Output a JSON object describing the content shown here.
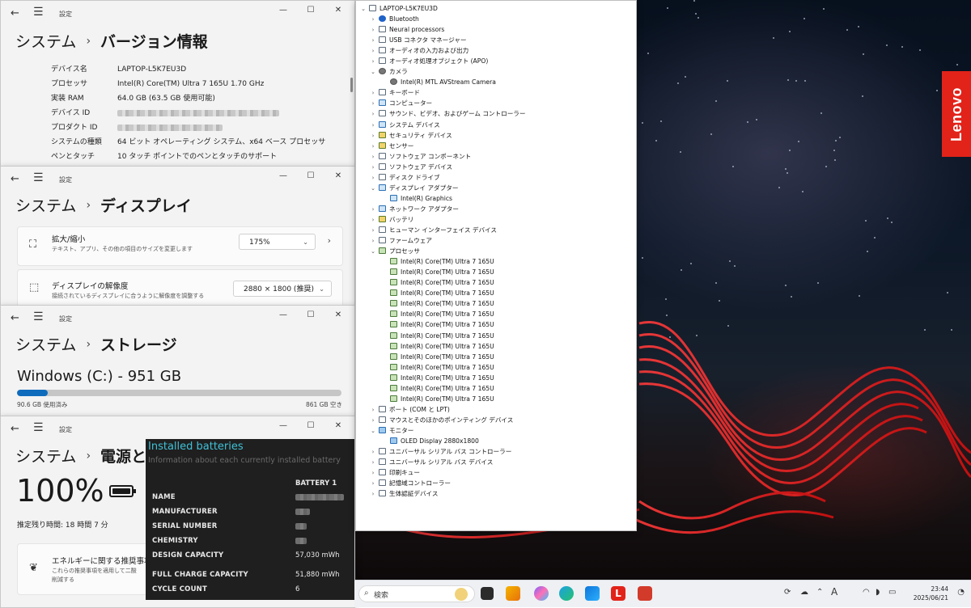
{
  "settings_app": "設定",
  "system_label": "システム",
  "windows": {
    "about": {
      "page_title": "バージョン情報",
      "specs": [
        {
          "key": "デバイス名",
          "value": "LAPTOP-L5K7EU3D"
        },
        {
          "key": "プロセッサ",
          "value": "Intel(R) Core(TM) Ultra 7 165U   1.70 GHz"
        },
        {
          "key": "実装 RAM",
          "value": "64.0 GB (63.5 GB 使用可能)"
        },
        {
          "key": "デバイス ID",
          "value": ""
        },
        {
          "key": "プロダクト ID",
          "value": ""
        },
        {
          "key": "システムの種類",
          "value": "64 ビット オペレーティング システム、x64 ベース プロセッサ"
        },
        {
          "key": "ペンとタッチ",
          "value": "10 タッチ ポイントでのペンとタッチのサポート"
        }
      ]
    },
    "display": {
      "page_title": "ディスプレイ",
      "scale": {
        "title": "拡大/縮小",
        "desc": "テキスト、アプリ、その他の項目のサイズを変更します",
        "value": "175%"
      },
      "resolution": {
        "title": "ディスプレイの解像度",
        "desc": "接続されているディスプレイに合うように解像度を調整する",
        "value": "2880 × 1800 (推奨)"
      }
    },
    "storage": {
      "page_title": "ストレージ",
      "drive": "Windows (C:) - 951 GB",
      "used": "90.6 GB 使用済み",
      "free": "861 GB 空き",
      "used_fraction": 0.095
    },
    "power": {
      "page_title": "電源とバ",
      "percent": "100%",
      "remaining_label": "推定残り時間:",
      "remaining_value": "18 時間 7 分",
      "energy_title": "エネルギーに関する推奨事項",
      "energy_desc_1": "これらの推奨事項を適用して二酸",
      "energy_desc_2": "削減する"
    }
  },
  "battery_report": {
    "title": "Installed batteries",
    "subtitle": "Information about each currently installed battery",
    "column": "BATTERY 1",
    "rows": [
      {
        "key": "NAME",
        "value": ""
      },
      {
        "key": "MANUFACTURER",
        "value": ""
      },
      {
        "key": "SERIAL NUMBER",
        "value": ""
      },
      {
        "key": "CHEMISTRY",
        "value": ""
      },
      {
        "key": "DESIGN CAPACITY",
        "value": "57,030 mWh"
      },
      {
        "key": "FULL CHARGE CAPACITY",
        "value": "51,880 mWh"
      },
      {
        "key": "CYCLE COUNT",
        "value": "6"
      }
    ]
  },
  "device_manager": {
    "root": "LAPTOP-L5K7EU3D",
    "nodes": [
      {
        "label": "Bluetooth",
        "depth": 1,
        "state": "collapsed",
        "icon": "bt"
      },
      {
        "label": "Neural processors",
        "depth": 1,
        "state": "collapsed",
        "icon": "gen"
      },
      {
        "label": "USB コネクタ マネージャー",
        "depth": 1,
        "state": "collapsed",
        "icon": "gen"
      },
      {
        "label": "オーディオの入力および出力",
        "depth": 1,
        "state": "collapsed",
        "icon": "gen"
      },
      {
        "label": "オーディオ処理オブジェクト (APO)",
        "depth": 1,
        "state": "collapsed",
        "icon": "gen"
      },
      {
        "label": "カメラ",
        "depth": 1,
        "state": "expanded",
        "icon": "cam"
      },
      {
        "label": "Intel(R) MTL AVStream Camera",
        "depth": 2,
        "state": "leaf",
        "icon": "cam"
      },
      {
        "label": "キーボード",
        "depth": 1,
        "state": "collapsed",
        "icon": "gen"
      },
      {
        "label": "コンピューター",
        "depth": 1,
        "state": "collapsed",
        "icon": "disp"
      },
      {
        "label": "サウンド、ビデオ、およびゲーム コントローラー",
        "depth": 1,
        "state": "collapsed",
        "icon": "gen"
      },
      {
        "label": "システム デバイス",
        "depth": 1,
        "state": "collapsed",
        "icon": "disp"
      },
      {
        "label": "セキュリティ デバイス",
        "depth": 1,
        "state": "collapsed",
        "icon": "sec"
      },
      {
        "label": "センサー",
        "depth": 1,
        "state": "collapsed",
        "icon": "sec"
      },
      {
        "label": "ソフトウェア コンポーネント",
        "depth": 1,
        "state": "collapsed",
        "icon": "gen"
      },
      {
        "label": "ソフトウェア デバイス",
        "depth": 1,
        "state": "collapsed",
        "icon": "gen"
      },
      {
        "label": "ディスク ドライブ",
        "depth": 1,
        "state": "collapsed",
        "icon": "gen"
      },
      {
        "label": "ディスプレイ アダプター",
        "depth": 1,
        "state": "expanded",
        "icon": "disp"
      },
      {
        "label": "Intel(R) Graphics",
        "depth": 2,
        "state": "leaf",
        "icon": "disp"
      },
      {
        "label": "ネットワーク アダプター",
        "depth": 1,
        "state": "collapsed",
        "icon": "disp"
      },
      {
        "label": "バッテリ",
        "depth": 1,
        "state": "collapsed",
        "icon": "sec"
      },
      {
        "label": "ヒューマン インターフェイス デバイス",
        "depth": 1,
        "state": "collapsed",
        "icon": "gen"
      },
      {
        "label": "ファームウェア",
        "depth": 1,
        "state": "collapsed",
        "icon": "gen"
      },
      {
        "label": "プロセッサ",
        "depth": 1,
        "state": "expanded",
        "icon": "cpu"
      },
      {
        "label": "Intel(R) Core(TM) Ultra 7 165U",
        "depth": 2,
        "state": "leaf",
        "icon": "cpu"
      },
      {
        "label": "Intel(R) Core(TM) Ultra 7 165U",
        "depth": 2,
        "state": "leaf",
        "icon": "cpu"
      },
      {
        "label": "Intel(R) Core(TM) Ultra 7 165U",
        "depth": 2,
        "state": "leaf",
        "icon": "cpu"
      },
      {
        "label": "Intel(R) Core(TM) Ultra 7 165U",
        "depth": 2,
        "state": "leaf",
        "icon": "cpu"
      },
      {
        "label": "Intel(R) Core(TM) Ultra 7 165U",
        "depth": 2,
        "state": "leaf",
        "icon": "cpu"
      },
      {
        "label": "Intel(R) Core(TM) Ultra 7 165U",
        "depth": 2,
        "state": "leaf",
        "icon": "cpu"
      },
      {
        "label": "Intel(R) Core(TM) Ultra 7 165U",
        "depth": 2,
        "state": "leaf",
        "icon": "cpu"
      },
      {
        "label": "Intel(R) Core(TM) Ultra 7 165U",
        "depth": 2,
        "state": "leaf",
        "icon": "cpu"
      },
      {
        "label": "Intel(R) Core(TM) Ultra 7 165U",
        "depth": 2,
        "state": "leaf",
        "icon": "cpu"
      },
      {
        "label": "Intel(R) Core(TM) Ultra 7 165U",
        "depth": 2,
        "state": "leaf",
        "icon": "cpu"
      },
      {
        "label": "Intel(R) Core(TM) Ultra 7 165U",
        "depth": 2,
        "state": "leaf",
        "icon": "cpu"
      },
      {
        "label": "Intel(R) Core(TM) Ultra 7 165U",
        "depth": 2,
        "state": "leaf",
        "icon": "cpu"
      },
      {
        "label": "Intel(R) Core(TM) Ultra 7 165U",
        "depth": 2,
        "state": "leaf",
        "icon": "cpu"
      },
      {
        "label": "Intel(R) Core(TM) Ultra 7 165U",
        "depth": 2,
        "state": "leaf",
        "icon": "cpu"
      },
      {
        "label": "ポート (COM と LPT)",
        "depth": 1,
        "state": "collapsed",
        "icon": "gen"
      },
      {
        "label": "マウスとそのほかのポインティング デバイス",
        "depth": 1,
        "state": "collapsed",
        "icon": "gen"
      },
      {
        "label": "モニター",
        "depth": 1,
        "state": "expanded",
        "icon": "mon"
      },
      {
        "label": "OLED Display 2880x1800",
        "depth": 2,
        "state": "leaf",
        "icon": "mon"
      },
      {
        "label": "ユニバーサル シリアル バス コントローラー",
        "depth": 1,
        "state": "collapsed",
        "icon": "gen"
      },
      {
        "label": "ユニバーサル シリアル バス デバイス",
        "depth": 1,
        "state": "collapsed",
        "icon": "gen"
      },
      {
        "label": "印刷キュー",
        "depth": 1,
        "state": "collapsed",
        "icon": "gen"
      },
      {
        "label": "記憶域コントローラー",
        "depth": 1,
        "state": "collapsed",
        "icon": "gen"
      },
      {
        "label": "生体認証デバイス",
        "depth": 1,
        "state": "collapsed",
        "icon": "gen"
      }
    ]
  },
  "taskbar": {
    "search_placeholder": "検索",
    "time": "23:44",
    "date": "2025/06/21",
    "ime": "A",
    "apps": [
      "file-explorer-icon",
      "copilot-icon",
      "edge-icon",
      "store-icon",
      "lenovo-vantage-icon",
      "lenovo-commercial-icon"
    ]
  },
  "wallpaper": {
    "brand": "Lenovo",
    "brand_color": "#e2231a"
  }
}
